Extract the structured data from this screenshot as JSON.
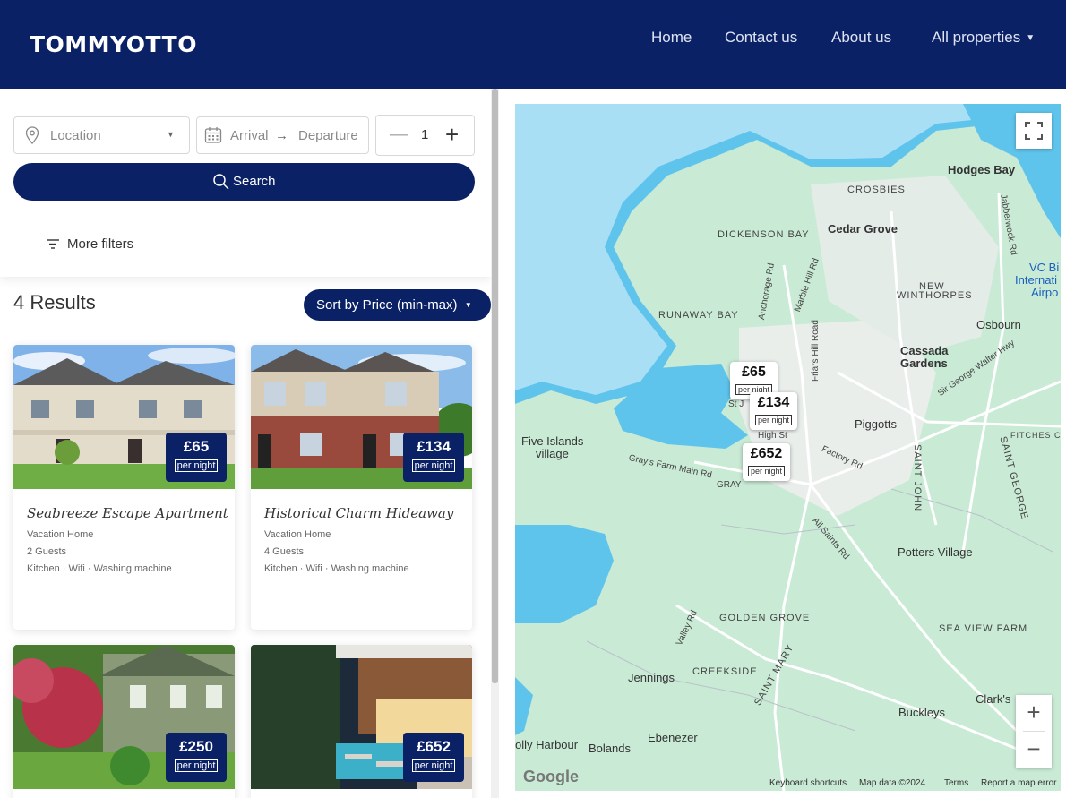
{
  "header": {
    "logo": "TOMMYOTTO",
    "nav": [
      "Home",
      "Contact us",
      "About us",
      "All properties"
    ]
  },
  "filters": {
    "location_placeholder": "Location",
    "arrival_placeholder": "Arrival",
    "departure_placeholder": "Departure",
    "guests_value": "1",
    "search_label": "Search",
    "more_filters_label": "More filters"
  },
  "results": {
    "count_label": "4 Results",
    "sort_label": "Sort by Price (min-max)"
  },
  "listings": [
    {
      "title": "Seabreeze Escape Apartment",
      "type": "Vacation Home",
      "guests": "2 Guests",
      "amenities": "Kitchen · Wifi · Washing machine",
      "price": "£65",
      "per": "per night"
    },
    {
      "title": "Historical Charm Hideaway",
      "type": "Vacation Home",
      "guests": "4 Guests",
      "amenities": "Kitchen · Wifi · Washing machine",
      "price": "£134",
      "per": "per night"
    },
    {
      "price": "£250",
      "per": "per night"
    },
    {
      "price": "£652",
      "per": "per night"
    }
  ],
  "map": {
    "markers": [
      {
        "price": "£65",
        "per": "per night"
      },
      {
        "price": "£134",
        "per": "per night"
      },
      {
        "price": "£652",
        "per": "per night"
      }
    ],
    "places": [
      "Hodges Bay",
      "CROSBIES",
      "Cedar Grove",
      "DICKENSON BAY",
      "VC Bi",
      "Internati",
      "Airpo",
      "NEW",
      "WINTHORPES",
      "Osbourn",
      "RUNAWAY BAY",
      "Cassada",
      "Gardens",
      "Piggotts",
      "Five Islands",
      "village",
      "Potters Village",
      "GOLDEN GROVE",
      "SEA VIEW FARM",
      "CREEKSIDE",
      "Jennings",
      "Clark's",
      "Buckleys",
      "Ebenezer",
      "olly Harbour",
      "Bolands",
      "SAINT JOHN",
      "SAINT GEORGE",
      "FITCHES CI",
      "SAINT MARY",
      "Anchorage Rd",
      "Marble Hill Rd",
      "Friars Hill Road",
      "Sir George Walter Hwy",
      "Jabberwock Rd",
      "Gray's Farm Main Rd",
      "GRAY",
      "High St",
      "St J",
      "Factory Rd",
      "All Saints Rd",
      "Valley Rd"
    ],
    "attribution": [
      "Keyboard shortcuts",
      "Map data ©2024",
      "Terms",
      "Report a map error"
    ],
    "google": "Google"
  }
}
